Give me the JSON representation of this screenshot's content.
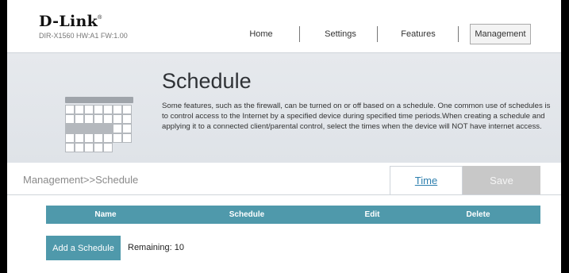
{
  "header": {
    "logo": "D-Link",
    "logo_mark": "®",
    "model_info": "DIR-X1560 HW:A1 FW:1.00",
    "nav": [
      {
        "label": "Home"
      },
      {
        "label": "Settings"
      },
      {
        "label": "Features"
      },
      {
        "label": "Management",
        "active": true
      }
    ]
  },
  "banner": {
    "icon": "calendar-icon",
    "title": "Schedule",
    "description": "Some features, such as the firewall, can be turned on or off based on a schedule. One common use of schedules is to control access to the Internet by a specified device during specified time periods.When creating a schedule and applying it to a connected client/parental control, select the times when the device will NOT have internet access."
  },
  "toolbar": {
    "breadcrumb": "Management>>Schedule",
    "time_label": "Time",
    "save_label": "Save"
  },
  "table": {
    "columns": [
      "Name",
      "Schedule",
      "Edit",
      "Delete"
    ],
    "rows": []
  },
  "footer": {
    "add_label": "Add a Schedule",
    "remaining": "Remaining: 10"
  },
  "colors": {
    "accent": "#4f99ab",
    "link": "#2e7fae",
    "disabled": "#c8c8c8"
  }
}
